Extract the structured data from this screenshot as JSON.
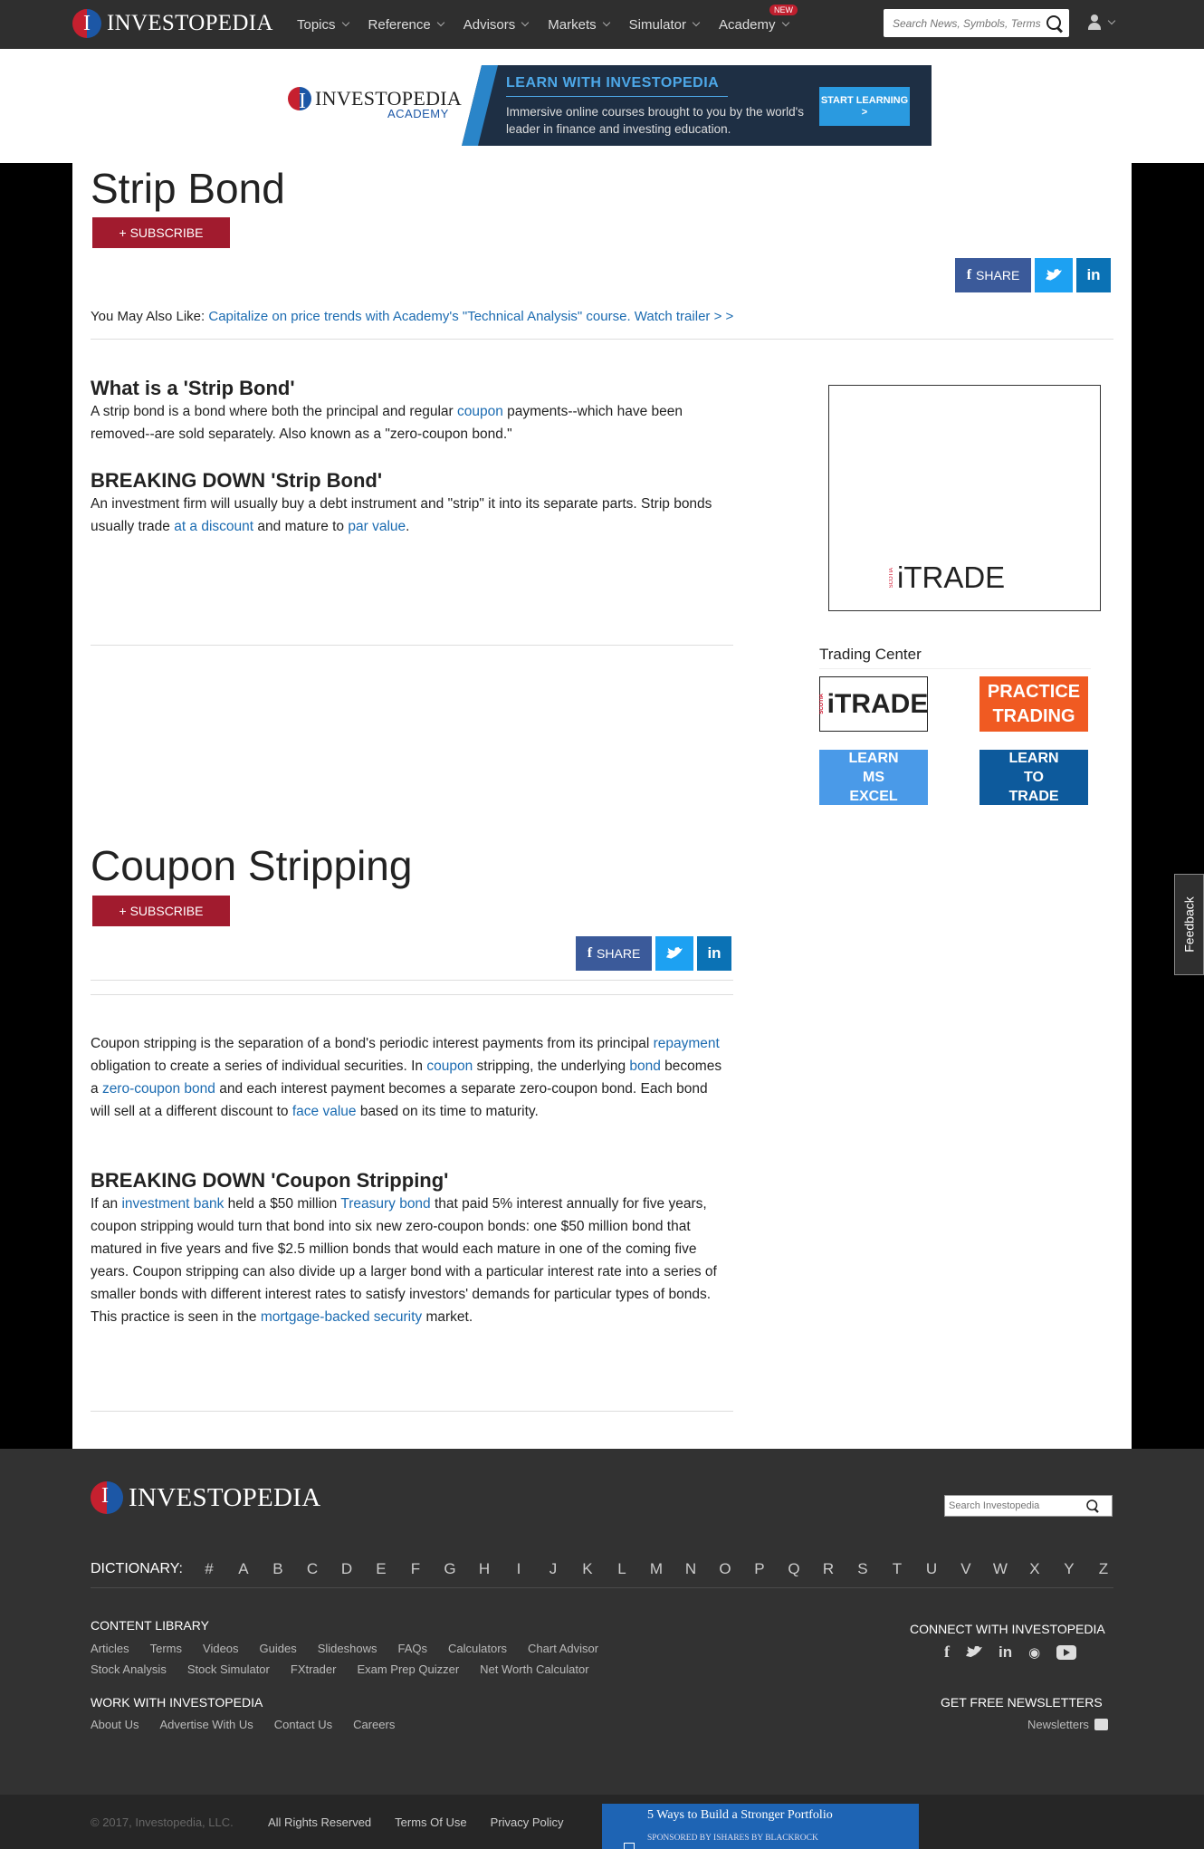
{
  "header": {
    "logo_text": "INVESTOPEDIA",
    "nav": [
      {
        "label": "Topics"
      },
      {
        "label": "Reference"
      },
      {
        "label": "Advisors"
      },
      {
        "label": "Markets"
      },
      {
        "label": "Simulator"
      },
      {
        "label": "Academy",
        "badge": "NEW"
      }
    ],
    "search_placeholder": "Search News, Symbols, Terms"
  },
  "banner": {
    "logo_text": "INVESTOPEDIA",
    "logo_sub": "ACADEMY",
    "title": "LEARN WITH INVESTOPEDIA",
    "text": "Immersive online courses brought to you by the world's leader in finance and investing education.",
    "button": "START LEARNING >"
  },
  "article1": {
    "title": "Strip Bond",
    "subscribe": "+ SUBSCRIBE",
    "share": "SHARE",
    "also_like_label": "You May Also Like:",
    "also_like_link": "Capitalize on price trends with Academy's \"Technical Analysis\" course. Watch trailer > >",
    "h_what": "What is a 'Strip Bond'",
    "p_what": [
      "A strip bond is a bond where both the principal and regular ",
      "coupon",
      " payments--which have been removed--are sold separately. Also known as a \"zero-coupon bond.\""
    ],
    "h_break": "BREAKING DOWN 'Strip Bond'",
    "p_break": [
      "An investment firm will usually buy a debt instrument and \"strip\" it into its separate parts. Strip bonds usually trade ",
      "at a discount",
      " and mature to ",
      "par value",
      "."
    ]
  },
  "sidebar": {
    "ad_brand": "iTRADE",
    "ad_scotia": "SCOTIA",
    "trading_center": "Trading Center",
    "tiles": [
      {
        "label": "iTRADE"
      },
      {
        "label": "PRACTICE TRADING",
        "color": "#f05a22"
      },
      {
        "label": "LEARN MS EXCEL",
        "color": "#4a9ae8"
      },
      {
        "label": "LEARN TO TRADE",
        "color": "#0d5a9c"
      }
    ]
  },
  "article2": {
    "title": "Coupon Stripping",
    "subscribe": "+ SUBSCRIBE",
    "share": "SHARE",
    "p_intro": [
      "Coupon stripping is the separation of a bond's periodic interest payments from its principal ",
      "repayment",
      " obligation to create a series of individual securities. In ",
      "coupon",
      " stripping, the underlying ",
      "bond",
      " becomes a ",
      "zero-coupon bond",
      " and each interest payment becomes a separate zero-coupon bond. Each bond will sell at a different discount to ",
      "face value",
      " based on its time to maturity."
    ],
    "h_break": "BREAKING DOWN 'Coupon Stripping'",
    "p_break": [
      "If an ",
      "investment bank",
      " held a $50 million ",
      "Treasury bond",
      " that paid 5% interest annually for five years, coupon stripping would turn that bond into six new zero-coupon bonds: one $50 million bond that matured in five years and five $2.5 million bonds that would each mature in one of the coming five years. Coupon stripping can also divide up a larger bond with a particular interest rate into a series of smaller bonds with different interest rates to satisfy investors' demands for particular types of bonds. This practice is seen in the ",
      "mortgage-backed security",
      " market."
    ]
  },
  "feedback": "Feedback",
  "footer": {
    "logo_text": "INVESTOPEDIA",
    "search_placeholder": "Search Investopedia",
    "dictionary_label": "DICTIONARY:",
    "letters": [
      "#",
      "A",
      "B",
      "C",
      "D",
      "E",
      "F",
      "G",
      "H",
      "I",
      "J",
      "K",
      "L",
      "M",
      "N",
      "O",
      "P",
      "Q",
      "R",
      "S",
      "T",
      "U",
      "V",
      "W",
      "X",
      "Y",
      "Z"
    ],
    "content_library": "CONTENT LIBRARY",
    "content_links_1": [
      "Articles",
      "Terms",
      "Videos",
      "Guides",
      "Slideshows",
      "FAQs",
      "Calculators",
      "Chart Advisor"
    ],
    "content_links_2": [
      "Stock Analysis",
      "Stock Simulator",
      "FXtrader",
      "Exam Prep Quizzer",
      "Net Worth Calculator"
    ],
    "work_with": "WORK WITH INVESTOPEDIA",
    "work_links": [
      "About Us",
      "Advertise With Us",
      "Contact Us",
      "Careers"
    ],
    "connect": "CONNECT WITH INVESTOPEDIA",
    "newsletters_title": "GET FREE NEWSLETTERS",
    "newsletters_link": "Newsletters",
    "copyright": "© 2017, Investopedia, LLC.",
    "bottom_links": [
      "All Rights Reserved",
      "Terms Of Use",
      "Privacy Policy"
    ],
    "promo_title": "5 Ways to Build a Stronger Portfolio",
    "promo_sponsor": "SPONSORED BY ISHARES BY BLACKROCK"
  }
}
